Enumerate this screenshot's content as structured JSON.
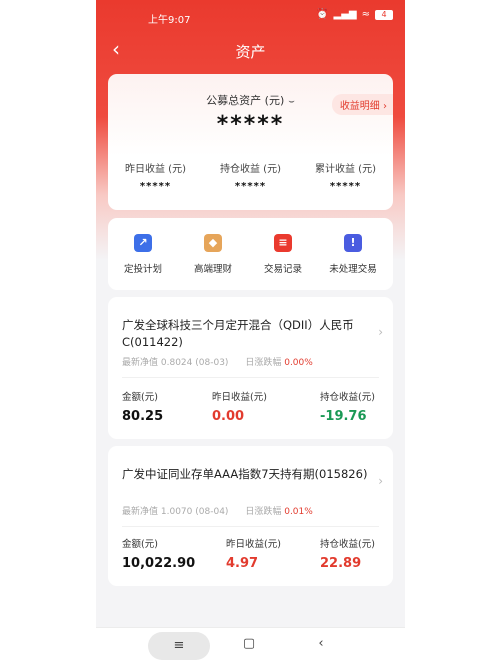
{
  "status_bar": {
    "time": "上午9:07",
    "icons": [
      "alarm-icon",
      "signal-icon",
      "wifi-icon"
    ],
    "battery": "4"
  },
  "nav": {
    "title": "资产",
    "back": "‹"
  },
  "asset_card": {
    "title": "公募总资产 (元)",
    "eye": "⌣",
    "total": "*****",
    "detail_link": "收益明细 ›",
    "stats": [
      {
        "label": "昨日收益 (元)",
        "value": "*****"
      },
      {
        "label": "持仓收益 (元)",
        "value": "*****"
      },
      {
        "label": "累计收益 (元)",
        "value": "*****"
      }
    ]
  },
  "quick_actions": [
    {
      "label": "定投计划",
      "icon": "chart-icon",
      "glyph": "↗",
      "color": "#3d6fe8"
    },
    {
      "label": "高端理财",
      "icon": "diamond-icon",
      "glyph": "◆",
      "color": "#e6a55a"
    },
    {
      "label": "交易记录",
      "icon": "document-icon",
      "glyph": "≡",
      "color": "#ea3a2e"
    },
    {
      "label": "未处理交易",
      "icon": "alert-icon",
      "glyph": "!",
      "color": "#4a5ce0"
    }
  ],
  "funds": [
    {
      "name": "广发全球科技三个月定开混合（QDII）人民币C(011422)",
      "nav_label": "最新净值",
      "nav_value": "0.8024",
      "nav_date": "(08-03)",
      "change_label": "日涨跌幅",
      "change_value": "0.00%",
      "amount_label": "金额(元)",
      "amount": "80.25",
      "yday_label": "昨日收益(元)",
      "yday": "0.00",
      "hold_label": "持仓收益(元)",
      "hold": "-19.76"
    },
    {
      "name": "广发中证同业存单AAA指数7天持有期(015826)",
      "nav_label": "最新净值",
      "nav_value": "1.0070",
      "nav_date": "(08-04)",
      "change_label": "日涨跌幅",
      "change_value": "0.01%",
      "amount_label": "金额(元)",
      "amount": "10,022.90",
      "yday_label": "昨日收益(元)",
      "yday": "4.97",
      "hold_label": "持仓收益(元)",
      "hold": "22.89"
    }
  ],
  "bottom_nav": {
    "menu": "≡",
    "home": "▢",
    "back": "‹"
  },
  "colors": {
    "brand_red": "#ea3a2e",
    "loss_green": "#1a9955",
    "gain_red": "#e23b2e"
  }
}
